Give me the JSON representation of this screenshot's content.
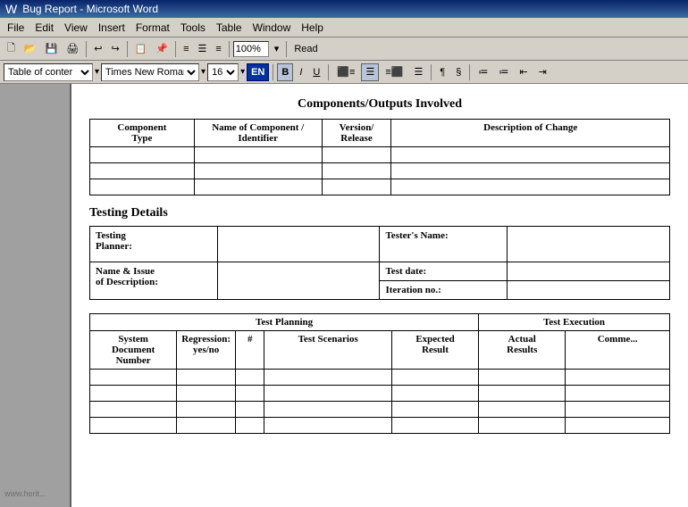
{
  "titleBar": {
    "icon": "W",
    "title": "Bug Report - Microsoft Word"
  },
  "menuBar": {
    "items": [
      "File",
      "Edit",
      "View",
      "Insert",
      "Format",
      "Tools",
      "Table",
      "Window",
      "Help"
    ]
  },
  "toolbar": {
    "zoom": "100%",
    "readBtn": "Read"
  },
  "formatBar": {
    "style": "Table of conter",
    "font": "Times New Roman",
    "size": "16",
    "lang": "EN",
    "boldLabel": "B",
    "italicLabel": "I",
    "underlineLabel": "U"
  },
  "document": {
    "section1Title": "Components/Outputs Involved",
    "table1Headers": [
      "Component Type",
      "Name of Component / Identifier",
      "Version/ Release",
      "Description of Change"
    ],
    "table1EmptyRows": 3,
    "section2Title": "Testing Details",
    "testingFields": [
      {
        "label": "Testing Planner:",
        "labelKey": "testingPlanner"
      },
      {
        "label": "Name & Issue of Description:",
        "labelKey": "nameIssue"
      }
    ],
    "testerLabel": "Tester's Name:",
    "testDateLabel": "Test date:",
    "iterationLabel": "Iteration no.:",
    "testPlanningLabel": "Test Planning",
    "testExecutionLabel": "Test Execution",
    "planningHeaders": [
      "System Document Number",
      "Regression: yes/no",
      "#",
      "Test Scenarios",
      "Expected Result",
      "Actual Results",
      "Comments"
    ],
    "planningEmptyRows": 4
  },
  "watermark": "www.herit..."
}
